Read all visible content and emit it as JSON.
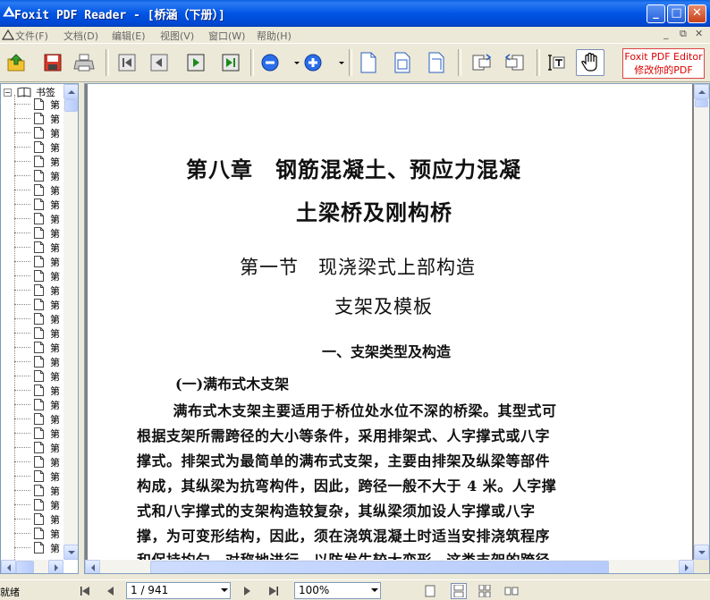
{
  "window": {
    "title": "Foxit PDF Reader - [桥涵（下册）]",
    "minimize": "_",
    "maximize": "□",
    "close": "✕"
  },
  "menu": {
    "items": [
      "文件(F)",
      "文档(D)",
      "编辑(E)",
      "视图(V)",
      "窗口(W)",
      "帮助(H)"
    ],
    "mdi": {
      "minimize": "_",
      "restore": "⧉",
      "close": "✕"
    }
  },
  "toolbar": {
    "icons": [
      "open-icon",
      "save-icon",
      "print-icon",
      "first-page-icon",
      "prev-page-icon",
      "next-page-icon",
      "last-page-icon",
      "zoom-out-icon",
      "zoom-in-icon",
      "fit-page-icon",
      "fit-width-icon",
      "actual-size-icon",
      "rotate-left-icon",
      "rotate-right-icon",
      "text-select-icon",
      "hand-icon"
    ],
    "promo_line1": "Foxit PDF Editor",
    "promo_line2": "修改你的PDF"
  },
  "bookmarks": {
    "root_expander": "−",
    "root_label": "书签",
    "item_label": "第",
    "item_count": 32
  },
  "document": {
    "chapter_line1": "第八章　钢筋混凝土、预应力混凝",
    "chapter_line2": "土梁桥及刚构桥",
    "section_line1": "第一节　现浇梁式上部构造",
    "section_line2": "支架及模板",
    "heading1": "一、支架类型及构造",
    "heading2": "(一)满布式木支架",
    "paragraph": [
      "　满布式木支架主要适用于桥位处水位不深的桥梁。其型式可",
      "根据支架所需跨径的大小等条件，采用排架式、人字撑式或八字",
      "撑式。排架式为最简单的满布式支架，主要由排架及纵梁等部件",
      "构成，其纵梁为抗弯构件，因此，跨径一般不大于 4 米。人字撑",
      "式和八字撑式的支架构造较复杂，其纵梁须加设人字撑或八字",
      "撑，为可变形结构，因此，须在浇筑混凝土时适当安排浇筑程序",
      "和保持均匀、对称地进行，以防发生较大变形。这类支架的跨径"
    ]
  },
  "status": {
    "text": "就绪",
    "page_indicator": "1 / 941",
    "zoom": "100%"
  }
}
